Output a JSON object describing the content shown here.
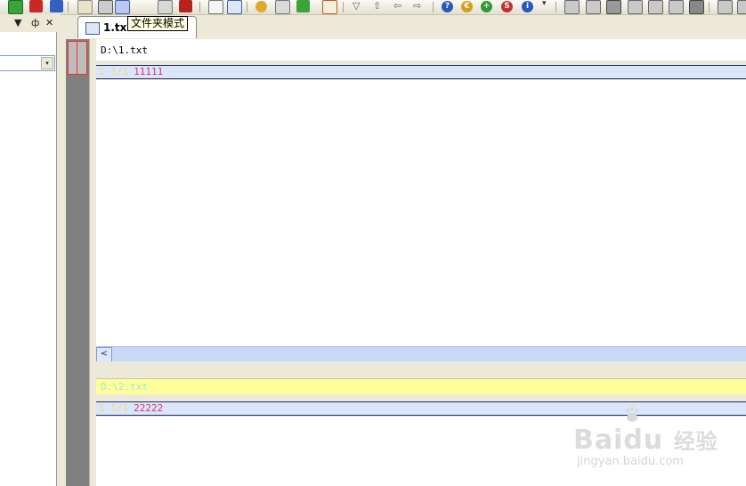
{
  "toolbar": {
    "overflow_glyph": "▾"
  },
  "left_panel": {
    "header_controls": [
      "▼",
      "ф",
      "✕"
    ],
    "dropdown_arrow": "▾"
  },
  "tab": {
    "label": "1.tx",
    "tooltip": "文件夹模式"
  },
  "pane_top": {
    "path": "D:\\1.txt",
    "line_number": "1 1/1",
    "line_text": "11111"
  },
  "pane_bottom": {
    "path": "D:\\2.txt",
    "line_number": "1 1/1",
    "line_text": "22222"
  },
  "scrollbar": {
    "left_arrow": "<"
  },
  "watermark": {
    "brand": "Bai",
    "brand_tail": "du",
    "brand_cn": "经验",
    "url": "jingyan.baidu.com"
  },
  "colors": {
    "highlight_line": "#dbe6fb",
    "path_bar_yellow": "#ffff9c",
    "code_text": "#d8366b",
    "gutter": "#808080"
  }
}
